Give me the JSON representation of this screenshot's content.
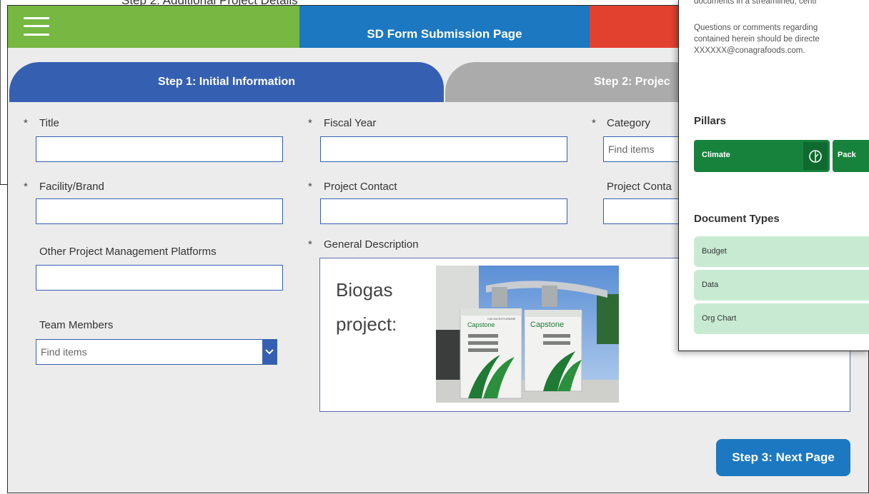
{
  "background": {
    "heading": "Step 2: Additional Project Details"
  },
  "header": {
    "title": "SD Form Submission Page",
    "menu_icon": "hamburger-menu-icon",
    "colors": {
      "left": "#76b842",
      "center": "#1c78c0",
      "right": "#e3412f"
    }
  },
  "tabs": [
    {
      "label": "Step 1: Initial Information",
      "active": true,
      "color": "#3560b2"
    },
    {
      "label": "Step 2: Projec",
      "active": false,
      "color": "#ababab"
    }
  ],
  "fields": {
    "title": {
      "label": "Title",
      "required": "*",
      "value": ""
    },
    "fiscal_year": {
      "label": "Fiscal Year",
      "required": "*",
      "value": ""
    },
    "category": {
      "label": "Category",
      "required": "*",
      "placeholder": "Find items"
    },
    "facility": {
      "label": "Facility/Brand",
      "required": "*",
      "value": ""
    },
    "project_contact": {
      "label": "Project Contact",
      "required": "*",
      "value": ""
    },
    "project_contact2": {
      "label": "Project Conta",
      "value": ""
    },
    "other_platforms": {
      "label": "Other Project Management Platforms",
      "value": ""
    },
    "team_members": {
      "label": "Team Members",
      "placeholder": "Find items",
      "dropdown_icon": "chevron-down-icon"
    },
    "general_description": {
      "label": "General Description",
      "required": "*",
      "text": "Biogas project:"
    }
  },
  "next_button": {
    "label": "Step 3: Next Page"
  },
  "photo": {
    "brand_text": "Capstone",
    "sub_text": "C65 MICROTURBINE"
  },
  "overlay": {
    "intro_line": "documents in a streamlined, centr",
    "contact_lines": [
      "Questions or comments regarding",
      "contained herein should be directe",
      "XXXXXX@conagrafoods.com."
    ],
    "pillars_heading": "Pillars",
    "pillars": [
      {
        "label": "Climate",
        "icon": "leaf-icon"
      },
      {
        "label": "Pack"
      }
    ],
    "doc_types_heading": "Document Types",
    "doc_types": [
      "Budget",
      "Data",
      "Org Chart"
    ]
  }
}
